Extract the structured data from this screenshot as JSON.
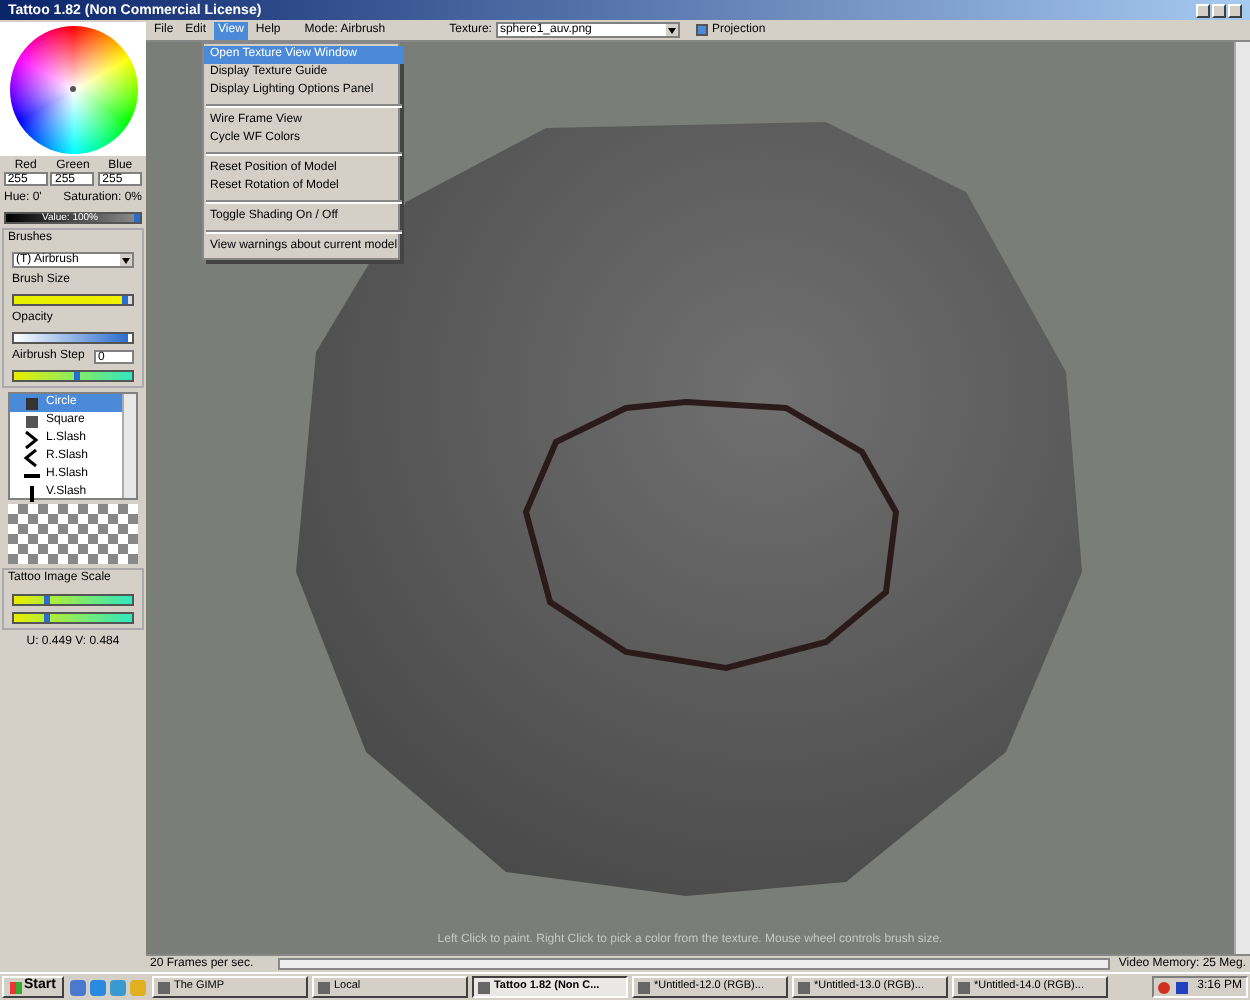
{
  "window": {
    "title": "Tattoo 1.82 (Non Commercial License)"
  },
  "menu": [
    {
      "label": "File",
      "selected": false
    },
    {
      "label": "Edit",
      "selected": false
    },
    {
      "label": "View",
      "selected": true
    },
    {
      "label": "Help",
      "selected": false
    }
  ],
  "mode": "Mode: Airbrush",
  "texture": {
    "label": "Texture:",
    "value": "sphere1_auv.png"
  },
  "projection": {
    "label": "Projection",
    "checked": true
  },
  "view_menu": [
    {
      "kind": "item",
      "label": "Open Texture View Window",
      "selected": true
    },
    {
      "kind": "item",
      "label": "Display Texture Guide",
      "selected": false
    },
    {
      "kind": "item",
      "label": "Display Lighting Options Panel",
      "selected": false
    },
    {
      "kind": "separator"
    },
    {
      "kind": "item",
      "label": "Wire Frame View",
      "selected": false
    },
    {
      "kind": "item",
      "label": "Cycle WF Colors",
      "selected": false
    },
    {
      "kind": "separator"
    },
    {
      "kind": "item",
      "label": "Reset Position of Model",
      "selected": false
    },
    {
      "kind": "item",
      "label": "Reset Rotation of Model",
      "selected": false
    },
    {
      "kind": "separator"
    },
    {
      "kind": "item",
      "label": "Toggle Shading On / Off",
      "selected": false
    },
    {
      "kind": "separator"
    },
    {
      "kind": "item",
      "label": "View warnings about current model",
      "selected": false
    }
  ],
  "color": {
    "channels": [
      {
        "label": "Red",
        "value": "255"
      },
      {
        "label": "Green",
        "value": "255"
      },
      {
        "label": "Blue",
        "value": "255"
      }
    ],
    "hue": "Hue: 0'",
    "saturation": "Saturation: 0%",
    "value_label": "Value: 100%",
    "level": 1
  },
  "brushes": {
    "title": "Brushes",
    "selected_brush": "(T) Airbrush",
    "brush_size": {
      "label": "Brush Size",
      "level": 0.96
    },
    "opacity": {
      "label": "Opacity",
      "level": 0.96
    },
    "airbrush_step": {
      "label": "Airbrush Step",
      "value": "0",
      "level": 0.5
    },
    "shapes": [
      {
        "label": "Circle",
        "selected": true
      },
      {
        "label": "Square",
        "selected": false
      },
      {
        "label": "L.Slash",
        "selected": false
      },
      {
        "label": "R.Slash",
        "selected": false
      },
      {
        "label": "H.Slash",
        "selected": false
      },
      {
        "label": "V.Slash",
        "selected": false
      }
    ]
  },
  "tattoo_scale": {
    "label": "Tattoo Image Scale",
    "sliders": [
      {
        "level": 0.25
      },
      {
        "level": 0.25
      }
    ],
    "uv": "U: 0.449 V: 0.484"
  },
  "viewport_hint": "Left Click to paint. Right Click to pick a color from the texture. Mouse wheel controls brush size.",
  "status_bar": {
    "fps": "20 Frames per sec.",
    "memory": "Video Memory: 25 Meg."
  },
  "taskbar": {
    "start": "Start",
    "tasks": [
      {
        "label": "The GIMP",
        "selected": false
      },
      {
        "label": "Local",
        "selected": false
      },
      {
        "label": "Tattoo 1.82 (Non C...",
        "selected": true
      },
      {
        "label": "*Untitled-12.0 (RGB)...",
        "selected": false
      },
      {
        "label": "*Untitled-13.0 (RGB)...",
        "selected": false
      },
      {
        "label": "*Untitled-14.0 (RGB)...",
        "selected": false
      }
    ],
    "clock": "3:16 PM"
  }
}
